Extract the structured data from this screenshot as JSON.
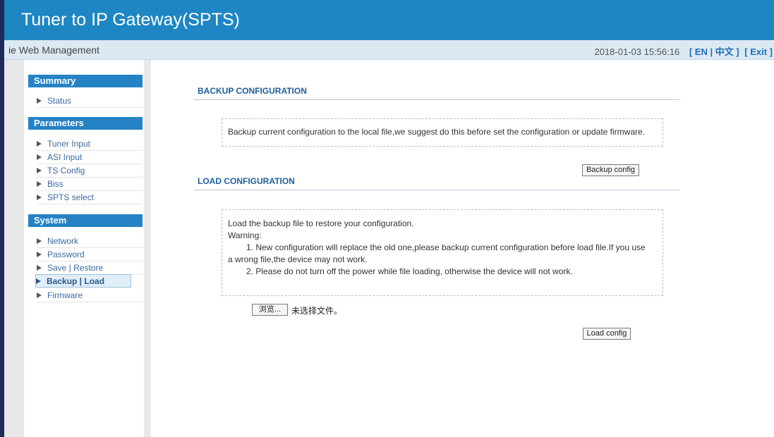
{
  "header": {
    "title": "Tuner to IP Gateway(SPTS)"
  },
  "subbar": {
    "left_text": "ie Web Management",
    "datetime": "2018-01-03 15:56:16",
    "lang": "[ EN | 中文 ]",
    "exit": "[ Exit ]"
  },
  "sidebar": {
    "summary": {
      "title": "Summary",
      "items": [
        "Status"
      ]
    },
    "parameters": {
      "title": "Parameters",
      "items": [
        "Tuner Input",
        "ASI Input",
        "TS Config",
        "Biss",
        "SPTS select"
      ]
    },
    "system": {
      "title": "System",
      "items": [
        "Network",
        "Password",
        "Save | Restore",
        "Backup | Load",
        "Firmware"
      ],
      "active": "Backup | Load"
    }
  },
  "backup": {
    "title": "BACKUP CONFIGURATION",
    "description": "Backup current configuration to the local file,we suggest do this before set the configuration or update firmware.",
    "button": "Backup config"
  },
  "load": {
    "title": "LOAD CONFIGURATION",
    "line1": "Load the backup file to restore your configuration.",
    "line2": "Warning:",
    "line3": "1. New configuration will replace the old one,please backup current configuration before load file.If you use",
    "line4": "a wrong file,the device may not work.",
    "line5": "2. Please do not turn off the power while file loading, otherwise the device will not work.",
    "browse_button": "浏览...",
    "file_status": "未选择文件。",
    "button": "Load config"
  },
  "colors": {
    "header": "#1d86c3",
    "subbar": "#dce9f3",
    "section_head": "#2582c4",
    "link": "#1d6fb8"
  }
}
